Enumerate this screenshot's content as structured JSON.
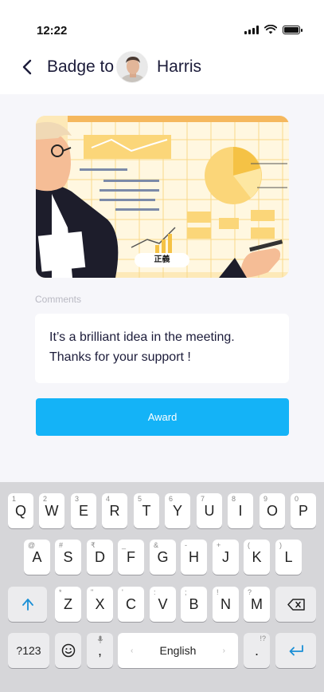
{
  "status_bar": {
    "time": "12:22"
  },
  "header": {
    "prefix": "Badge to",
    "recipient": "Harris"
  },
  "badge": {
    "label": "正義"
  },
  "comments": {
    "label": "Comments",
    "text": "It’s a brilliant idea in the meeting. Thanks for your support !"
  },
  "award_button": {
    "label": "Award"
  },
  "keyboard": {
    "row1": [
      {
        "key": "Q",
        "hint": "1"
      },
      {
        "key": "W",
        "hint": "2"
      },
      {
        "key": "E",
        "hint": "3"
      },
      {
        "key": "R",
        "hint": "4"
      },
      {
        "key": "T",
        "hint": "5"
      },
      {
        "key": "Y",
        "hint": "6"
      },
      {
        "key": "U",
        "hint": "7"
      },
      {
        "key": "I",
        "hint": "8"
      },
      {
        "key": "O",
        "hint": "9"
      },
      {
        "key": "P",
        "hint": "0"
      }
    ],
    "row2": [
      {
        "key": "A",
        "hint": "@"
      },
      {
        "key": "S",
        "hint": "#"
      },
      {
        "key": "D",
        "hint": "₹"
      },
      {
        "key": "F",
        "hint": "_"
      },
      {
        "key": "G",
        "hint": "&"
      },
      {
        "key": "H",
        "hint": "-"
      },
      {
        "key": "J",
        "hint": "+"
      },
      {
        "key": "K",
        "hint": "("
      },
      {
        "key": "L",
        "hint": ")"
      }
    ],
    "row3": [
      {
        "key": "Z",
        "hint": "*"
      },
      {
        "key": "X",
        "hint": "\""
      },
      {
        "key": "C",
        "hint": "'"
      },
      {
        "key": "V",
        "hint": ":"
      },
      {
        "key": "B",
        "hint": ";"
      },
      {
        "key": "N",
        "hint": "!"
      },
      {
        "key": "M",
        "hint": "?"
      }
    ],
    "symbols_label": "?123",
    "comma_label": ",",
    "space_label": "English",
    "period_label": ".",
    "period_hint": "!?"
  },
  "colors": {
    "accent": "#14b3f7",
    "background": "#f6f6fa",
    "title_text": "#1c1c3a",
    "keyboard_bg": "#d6d6d9"
  },
  "icons": {
    "back": "chevron-left-icon",
    "shift": "shift-arrow-icon",
    "backspace": "backspace-icon",
    "emoji": "emoji-icon",
    "mic": "mic-icon",
    "enter": "enter-icon"
  }
}
